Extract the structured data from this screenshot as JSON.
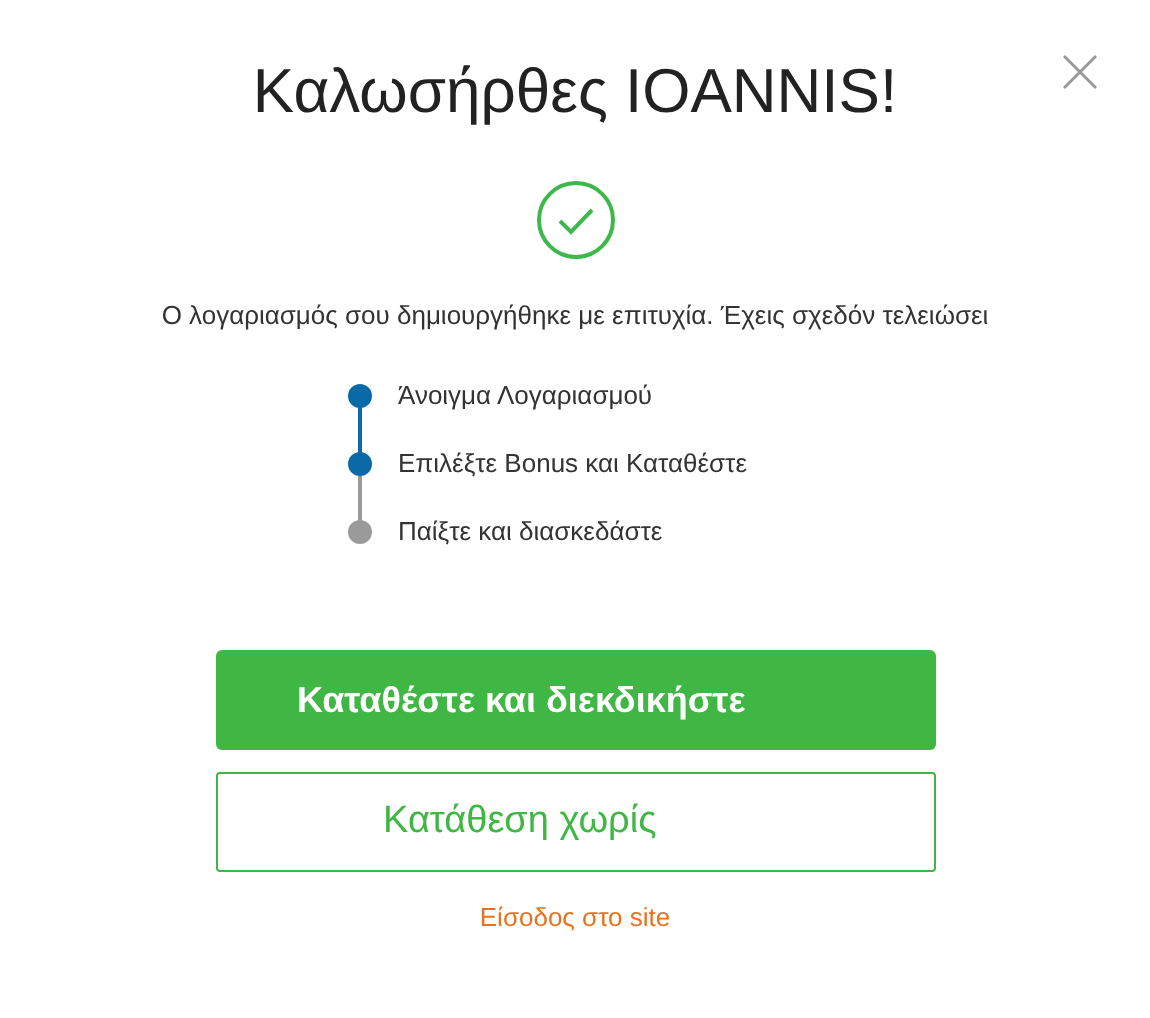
{
  "title": "Καλωσήρθες IOANNIS!",
  "message": "Ο λογαριασμός σου δημιουργήθηκε με επιτυχία. Έχεις σχεδόν τελειώσει",
  "steps": [
    {
      "label": "Άνοιγμα Λογαριασμού",
      "done": true
    },
    {
      "label": "Επιλέξτε Bonus και Καταθέστε",
      "done": true
    },
    {
      "label": "Παίξτε και διασκεδάστε",
      "done": false
    }
  ],
  "primary_button": "Καταθέστε και διεκδικήστε",
  "secondary_button": "Κατάθεση χωρίς",
  "link": "Είσοδος στο site"
}
